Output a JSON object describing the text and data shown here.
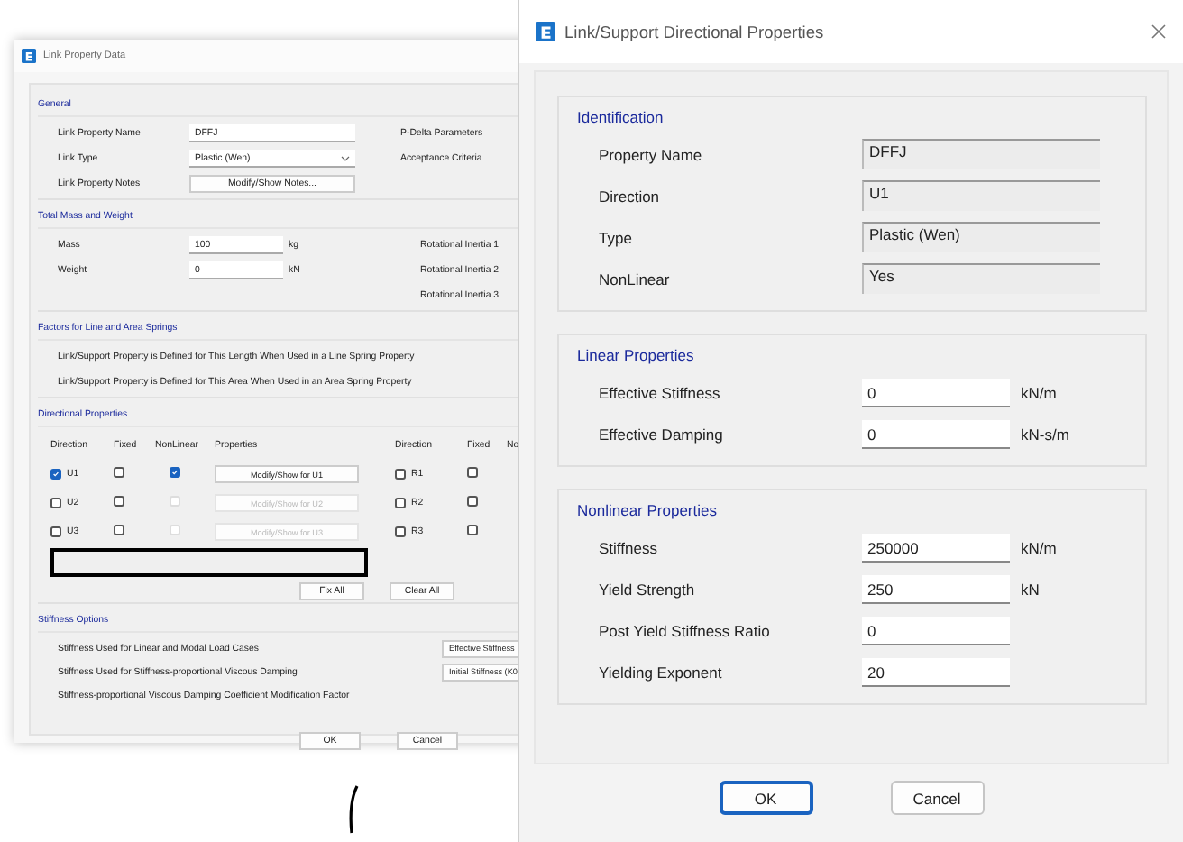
{
  "back_window": {
    "title": "Link Property Data",
    "general": {
      "title": "General",
      "rows": [
        {
          "label": "Link Property Name",
          "kind": "text",
          "value": "DFFJ"
        },
        {
          "label": "Link Type",
          "kind": "dropdown",
          "value": "Plastic (Wen)"
        },
        {
          "label": "Link Property Notes",
          "kind": "button",
          "value": "Modify/Show Notes..."
        }
      ],
      "side_labels": [
        "P-Delta Parameters",
        "Acceptance Criteria"
      ]
    },
    "mass": {
      "title": "Total Mass and Weight",
      "rows": [
        {
          "label": "Mass",
          "value": "100",
          "unit": "kg"
        },
        {
          "label": "Weight",
          "value": "0",
          "unit": "kN"
        }
      ],
      "side_labels": [
        "Rotational Inertia 1",
        "Rotational Inertia 2",
        "Rotational Inertia 3"
      ]
    },
    "factors": {
      "title": "Factors for Line and Area Springs",
      "lines": [
        "Link/Support Property is Defined for This Length When Used in a Line Spring Property",
        "Link/Support Property is Defined for This Area When Used in an Area Spring Property"
      ]
    },
    "directional": {
      "title": "Directional Properties",
      "columns": [
        "Direction",
        "Fixed",
        "NonLinear",
        "Properties",
        "Direction",
        "Fixed",
        "No"
      ],
      "rows": [
        {
          "direction": "U1",
          "checked": true,
          "fixed": false,
          "nonlinear": true,
          "disabled": false,
          "button": "Modify/Show for U1",
          "right_direction": "R1",
          "right_checked": false,
          "right_fixed": false
        },
        {
          "direction": "U2",
          "checked": false,
          "fixed": false,
          "nonlinear": false,
          "disabled": true,
          "button": "Modify/Show for U2",
          "right_direction": "R2",
          "right_checked": false,
          "right_fixed": false
        },
        {
          "direction": "U3",
          "checked": false,
          "fixed": false,
          "nonlinear": false,
          "disabled": true,
          "button": "Modify/Show for U3",
          "right_direction": "R3",
          "right_checked": false,
          "right_fixed": false
        }
      ],
      "buttons": [
        "Fix All",
        "Clear All"
      ]
    },
    "stiffness": {
      "title": "Stiffness Options",
      "lines": [
        "Stiffness Used for Linear and Modal Load Cases",
        "Stiffness Used for Stiffness-proportional Viscous Damping",
        "Stiffness-proportional Viscous Damping Coefficient Modification Factor"
      ],
      "buttons": [
        "Effective Stiffness",
        "Initial Stiffness (K0"
      ]
    },
    "buttons": [
      "OK",
      "Cancel"
    ]
  },
  "front_window": {
    "title": "Link/Support Directional Properties",
    "groups": [
      {
        "title": "Identification",
        "rows": [
          {
            "label": "Property Name",
            "kind": "readonly",
            "value": "DFFJ"
          },
          {
            "label": "Direction",
            "kind": "readonly",
            "value": "U1"
          },
          {
            "label": "Type",
            "kind": "readonly",
            "value": "Plastic (Wen)"
          },
          {
            "label": "NonLinear",
            "kind": "readonly",
            "value": "Yes"
          }
        ]
      },
      {
        "title": "Linear Properties",
        "rows": [
          {
            "label": "Effective Stiffness",
            "kind": "input",
            "value": "0",
            "unit": "kN/m"
          },
          {
            "label": "Effective Damping",
            "kind": "input",
            "value": "0",
            "unit": "kN-s/m"
          }
        ]
      },
      {
        "title": "Nonlinear Properties",
        "rows": [
          {
            "label": "Stiffness",
            "kind": "input",
            "value": "250000",
            "unit": "kN/m"
          },
          {
            "label": "Yield Strength",
            "kind": "input",
            "value": "250",
            "unit": "kN"
          },
          {
            "label": "Post Yield Stiffness Ratio",
            "kind": "input",
            "value": "0"
          },
          {
            "label": "Yielding Exponent",
            "kind": "input",
            "value": "20"
          }
        ]
      }
    ],
    "buttons": [
      {
        "label": "OK",
        "focused": true
      },
      {
        "label": "Cancel",
        "focused": false
      }
    ]
  }
}
